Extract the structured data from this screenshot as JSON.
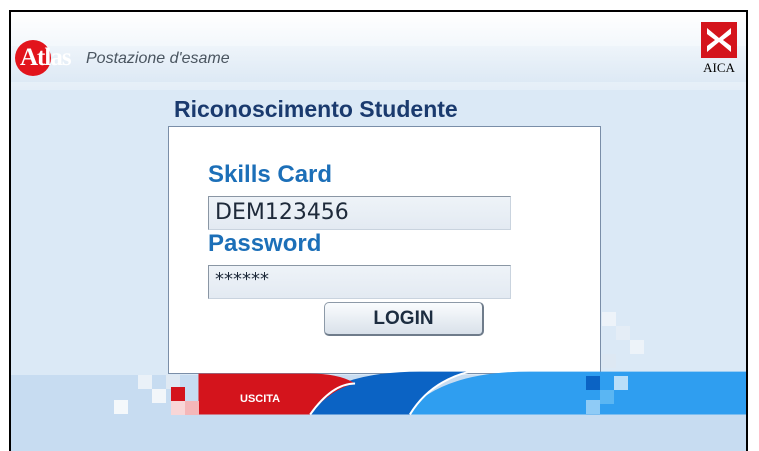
{
  "header": {
    "logo_text": "Atlas",
    "subtitle": "Postazione d'esame",
    "aica_text": "AICA"
  },
  "main": {
    "title": "Riconoscimento Studente",
    "skills_label": "Skills Card",
    "skills_value": "DEM123456",
    "password_label": "Password",
    "password_value": "******",
    "login_label": "LOGIN"
  },
  "footer": {
    "exit_label": "USCITA"
  },
  "colors": {
    "brand_red": "#e2141c",
    "label_blue": "#1c6fb8",
    "title_navy": "#1a3a6e",
    "footer_blue_dark": "#0b63c4",
    "footer_blue_light": "#2f9ef0"
  }
}
